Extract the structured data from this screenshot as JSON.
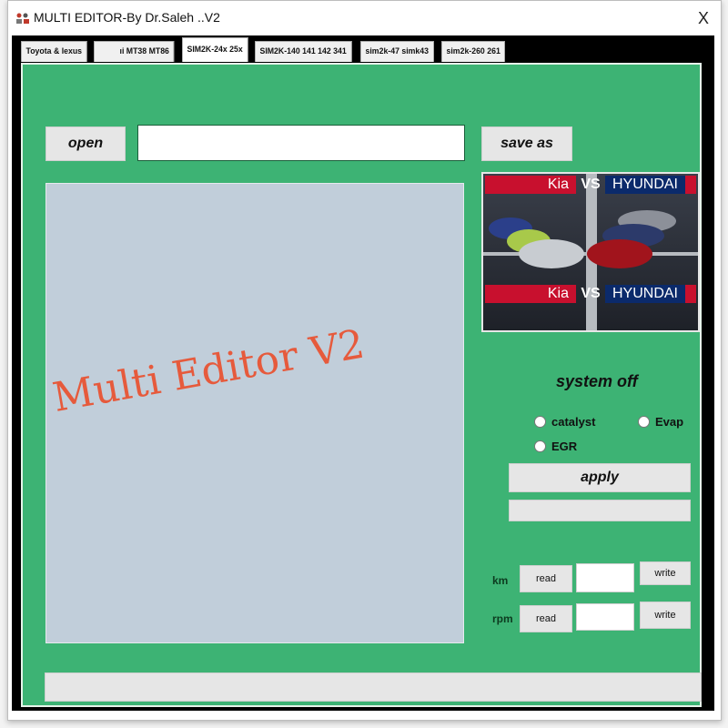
{
  "window": {
    "title": "MULTI EDITOR-By Dr.Saleh ..V2",
    "close_label": "X"
  },
  "tabs": [
    {
      "label": "Toyota & lexus",
      "active": false
    },
    {
      "label": "ıi MT38 MT86",
      "active": false
    },
    {
      "label": "SIM2K-24x 25x",
      "active": true
    },
    {
      "label": "SIM2K-140 141 142 341",
      "active": false
    },
    {
      "label": "sim2k-47 simk43",
      "active": false
    },
    {
      "label": "sim2k-260 261",
      "active": false
    }
  ],
  "toolbar": {
    "open_label": "open",
    "file_path_value": "",
    "save_as_label": "save as"
  },
  "editor": {
    "watermark": "Multi Editor V2"
  },
  "banner_image": {
    "left_brand": "Kia",
    "vs": "VS",
    "right_brand": "HYUNDAI"
  },
  "system_off": {
    "heading": "system off",
    "options": [
      {
        "label": "catalyst",
        "checked": false
      },
      {
        "label": "Evap",
        "checked": false
      },
      {
        "label": "EGR",
        "checked": false
      }
    ],
    "apply_label": "apply",
    "status_value": ""
  },
  "counters": {
    "km": {
      "label": "km",
      "read_label": "read",
      "value": "",
      "write_label": "write"
    },
    "rpm": {
      "label": "rpm",
      "read_label": "read",
      "value": "",
      "write_label": "write"
    }
  },
  "status_bar": {
    "value": ""
  },
  "colors": {
    "panel_green": "#3db374",
    "editor_bg": "#c1ceda",
    "watermark": "#e65a3c",
    "kia_red": "#c8102e",
    "hyundai_blue": "#0b2a6b"
  }
}
